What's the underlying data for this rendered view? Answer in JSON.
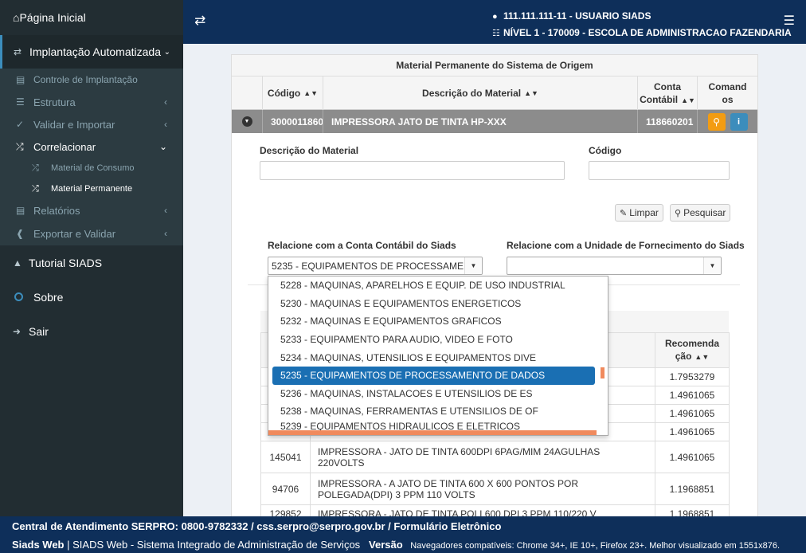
{
  "sidebar": {
    "home": "Página Inicial",
    "impl": "Implantação Automatizada",
    "controle": "Controle de Implantação",
    "estrutura": "Estrutura",
    "validar": "Validar e Importar",
    "correlacionar": "Correlacionar",
    "consumo": "Material de Consumo",
    "permanente": "Material Permanente",
    "relatorios": "Relatórios",
    "exportar": "Exportar e Validar",
    "tutorial": "Tutorial SIADS",
    "sobre": "Sobre",
    "sair": "Sair"
  },
  "header": {
    "user": "111.111.111-11 - USUARIO SIADS",
    "level": "NÍVEL 1 - 170009 - ESCOLA DE ADMINISTRACAO FAZENDARIA"
  },
  "panel": {
    "title": "Material Permanente do Sistema de Origem",
    "col_codigo": "Código",
    "col_descricao": "Descrição do Material",
    "col_conta_1": "Conta",
    "col_conta_2": "Contábil",
    "col_comandos_1": "Comand",
    "col_comandos_2": "os",
    "row": {
      "codigo": "3000011860",
      "descricao": "IMPRESSORA JATO DE TINTA HP-XXX",
      "conta": "118660201"
    }
  },
  "detail": {
    "desc_label": "Descrição do Material",
    "cod_label": "Código",
    "desc_value": "",
    "cod_value": "",
    "limpar": "Limpar",
    "pesquisar": "Pesquisar",
    "conta_label": "Relacione com a Conta Contábil do Siads",
    "unidade_label": "Relacione com a Unidade de Fornecimento do Siads",
    "conta_selected": "5235 - EQUIPAMENTOS DE PROCESSAMENTO DE DADOS",
    "unidade_selected": ""
  },
  "dropdown": {
    "options": [
      "5228 - MAQUINAS, APARELHOS E EQUIP. DE USO INDUSTRIAL",
      "5230 - MAQUINAS E EQUIPAMENTOS ENERGETICOS",
      "5232 - MAQUINAS E EQUIPAMENTOS GRAFICOS",
      "5233 - EQUIPAMENTO PARA AUDIO, VIDEO E FOTO",
      "5234 - MAQUINAS, UTENSILIOS E EQUIPAMENTOS DIVE",
      "5235 - EQUIPAMENTOS DE PROCESSAMENTO DE DADOS",
      "5236 - MAQUINAS, INSTALACOES E UTENSILIOS DE ES",
      "5238 - MAQUINAS, FERRAMENTAS E UTENSILIOS DE OF",
      "5239 - EQUIPAMENTOS HIDRAULICOS E ELETRICOS"
    ]
  },
  "table": {
    "col_rec_1": "Recomenda",
    "col_rec_2": "ção",
    "rows": [
      {
        "code": "",
        "desc": "",
        "rec": "1.7953279"
      },
      {
        "code": "",
        "desc": "",
        "rec": "1.4961065"
      },
      {
        "code": "",
        "desc": "",
        "rec": "1.4961065"
      },
      {
        "code": "",
        "desc": "",
        "rec": "1.4961065"
      },
      {
        "code": "145041",
        "desc": "IMPRESSORA - JATO DE TINTA 600DPI 6PAG/MIM 24AGULHAS 220VOLTS",
        "rec": "1.4961065"
      },
      {
        "code": "94706",
        "desc": "IMPRESSORA - A JATO DE TINTA 600 X 600 PONTOS POR POLEGADA(DPI) 3 PPM 110 VOLTS",
        "rec": "1.1968851"
      },
      {
        "code": "129852",
        "desc": "IMPRESSORA - JATO DE TINTA POLI 600 DPI 3 PPM 110/220 V",
        "rec": "1.1968851"
      }
    ]
  },
  "footer": {
    "line1": "Central de Atendimento SERPRO: 0800-9782332 / css.serpro@serpro.gov.br / Formulário Eletrônico",
    "brand": "Siads Web",
    "desc": "| SIADS Web - Sistema Integrado de Administração de Serviços",
    "versao": "Versão",
    "browsers": "Navegadores compatíveis: Chrome 34+, IE 10+, Firefox 23+. Melhor visualizado em 1551x876."
  }
}
